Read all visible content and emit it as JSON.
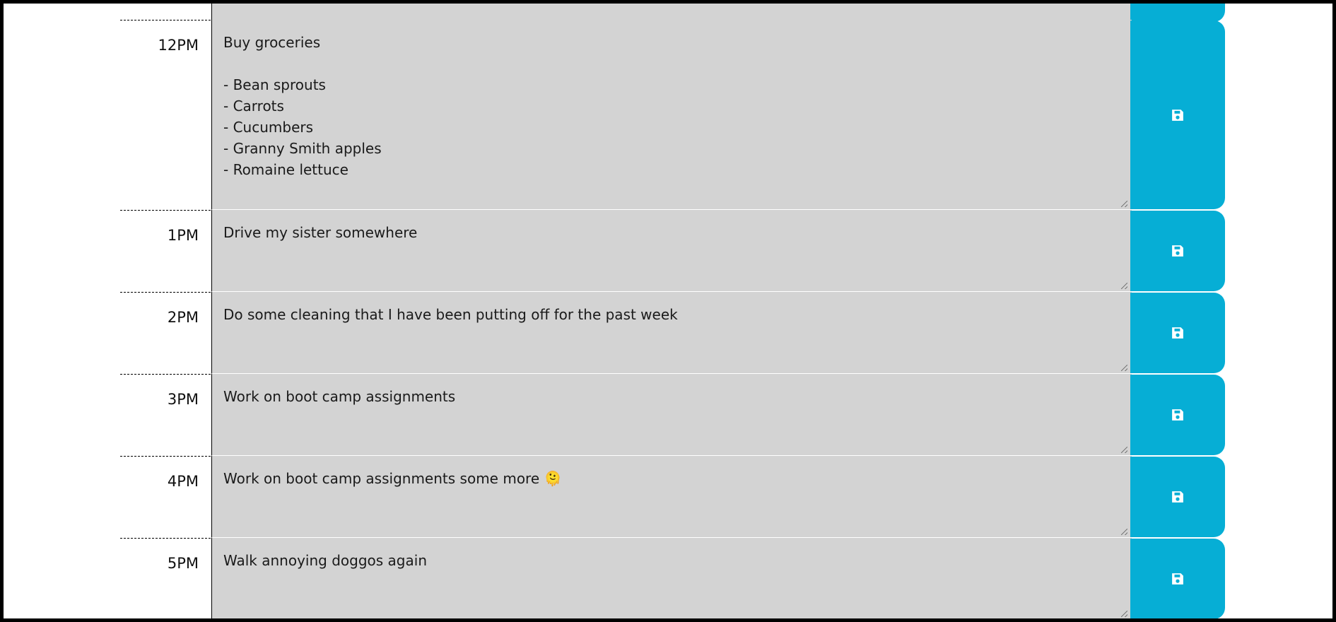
{
  "colors": {
    "save_button": "#06aed5",
    "description_bg": "#d3d3d3",
    "frame": "#000000"
  },
  "rows": [
    {
      "hour": "",
      "description": "",
      "icon": "floppy-disk-icon"
    },
    {
      "hour": "12PM",
      "description": "Buy groceries\n\n- Bean sprouts\n- Carrots\n- Cucumbers\n- Granny Smith apples\n- Romaine lettuce",
      "icon": "floppy-disk-icon"
    },
    {
      "hour": "1PM",
      "description": "Drive my sister somewhere",
      "icon": "floppy-disk-icon"
    },
    {
      "hour": "2PM",
      "description": "Do some cleaning that I have been putting off for the past week",
      "icon": "floppy-disk-icon"
    },
    {
      "hour": "3PM",
      "description": "Work on boot camp assignments",
      "icon": "floppy-disk-icon"
    },
    {
      "hour": "4PM",
      "description": "Work on boot camp assignments some more 🫠",
      "icon": "floppy-disk-icon"
    },
    {
      "hour": "5PM",
      "description": "Walk annoying doggos again",
      "icon": "floppy-disk-icon"
    }
  ]
}
